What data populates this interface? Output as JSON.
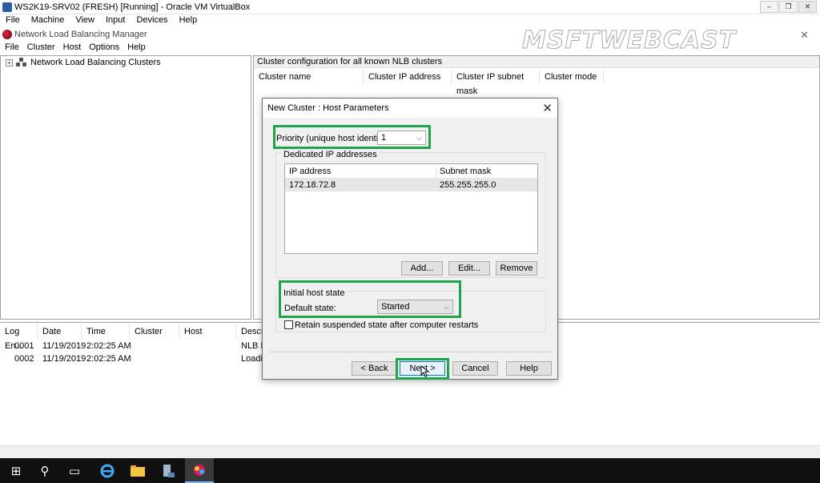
{
  "host_window": {
    "title": "WS2K19-SRV02 (FRESH) [Running] - Oracle VM VirtualBox",
    "menu": [
      "File",
      "Machine",
      "View",
      "Input",
      "Devices",
      "Help"
    ],
    "buttons": [
      "–",
      "❐",
      "✕"
    ]
  },
  "app": {
    "title": "Network Load Balancing Manager",
    "menu": [
      "File",
      "Cluster",
      "Host",
      "Options",
      "Help"
    ],
    "close_glyph": "✕"
  },
  "watermark": "MSFTWEBCAST",
  "tree": {
    "expander": "+",
    "root_label": "Network Load Balancing Clusters"
  },
  "right_pane": {
    "header": "Cluster configuration for all known NLB clusters",
    "columns": [
      "Cluster name",
      "Cluster IP address",
      "Cluster IP subnet mask",
      "Cluster mode"
    ]
  },
  "log": {
    "columns": [
      "Log En...",
      "Date",
      "Time",
      "Cluster",
      "Host",
      "Descri"
    ],
    "rows": [
      {
        "id": "0001",
        "date": "11/19/2019",
        "time": "2:02:25 AM",
        "cluster": "",
        "host": "",
        "desc": "NLB M"
      },
      {
        "id": "0002",
        "date": "11/19/2019",
        "time": "2:02:25 AM",
        "cluster": "",
        "host": "",
        "desc": "Loadin"
      }
    ]
  },
  "dialog": {
    "title": "New Cluster : Host Parameters",
    "close_glyph": "✕",
    "priority": {
      "label": "Priority (unique host identifier):",
      "value": "1"
    },
    "dedicated_ip": {
      "group_label": "Dedicated IP addresses",
      "columns": [
        "IP address",
        "Subnet mask"
      ],
      "rows": [
        {
          "ip": "172.18.72.8",
          "mask": "255.255.255.0"
        }
      ],
      "add_label": "Add...",
      "edit_label": "Edit...",
      "remove_label": "Remove"
    },
    "initial_state": {
      "group_label": "Initial host state",
      "default_label": "Default state:",
      "default_value": "Started",
      "retain_label": "Retain suspended state after computer restarts",
      "retain_checked": false
    },
    "buttons": {
      "back": "< Back",
      "next": "Next >",
      "cancel": "Cancel",
      "help": "Help"
    }
  },
  "taskbar": {
    "items": [
      "windows-start",
      "search",
      "task-view",
      "internet-explorer",
      "file-explorer",
      "server-manager",
      "nlb-manager"
    ],
    "glyphs": {
      "start": "⊞",
      "search": "⚲",
      "taskview": "▭"
    }
  },
  "highlight_color": "#1fa44a"
}
